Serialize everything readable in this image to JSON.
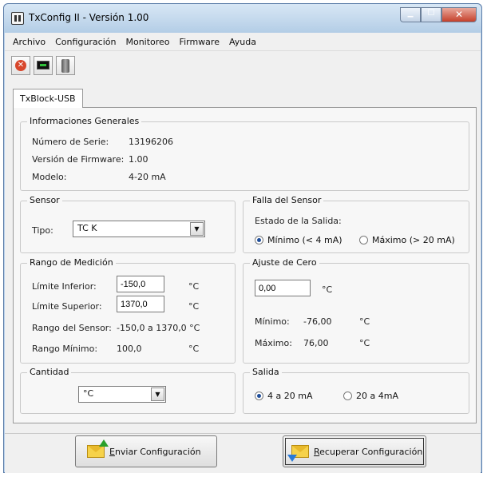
{
  "window": {
    "title": "TxConfig II - Versión 1.00"
  },
  "menu": [
    "Archivo",
    "Configuración",
    "Monitoreo",
    "Firmware",
    "Ayuda"
  ],
  "tab": {
    "label": "TxBlock-USB"
  },
  "info": {
    "title": "Informaciones Generales",
    "serial_label": "Número de Serie:",
    "serial_value": "13196206",
    "firmware_label": "Versión de Firmware:",
    "firmware_value": "1.00",
    "model_label": "Modelo:",
    "model_value": "4-20 mA"
  },
  "sensor": {
    "title": "Sensor",
    "type_label": "Tipo:",
    "type_value": "TC K"
  },
  "fault": {
    "title": "Falla del Sensor",
    "output_state_label": "Estado de la Salida:",
    "min_label": "Mínimo (< 4 mA)",
    "max_label": "Máximo (> 20 mA)",
    "selected": "min"
  },
  "range": {
    "title": "Rango de Medición",
    "lower_label": "Límite Inferior:",
    "lower_value": "-150,0",
    "lower_unit": "°C",
    "upper_label": "Límite Superior:",
    "upper_value": "1370,0",
    "upper_unit": "°C",
    "sensor_range_label": "Rango del Sensor:",
    "sensor_range_value": "-150,0 a 1370,0 °C",
    "min_range_label": "Rango Mínimo:",
    "min_range_value": "100,0",
    "min_range_unit": "°C"
  },
  "zero": {
    "title": "Ajuste de Cero",
    "value": "0,00",
    "unit": "°C",
    "min_label": "Mínimo:",
    "min_value": "-76,00",
    "min_unit": "°C",
    "max_label": "Máximo:",
    "max_value": "76,00",
    "max_unit": "°C"
  },
  "quantity": {
    "title": "Cantidad",
    "value": "°C"
  },
  "output": {
    "title": "Salida",
    "opt1": "4 a 20 mA",
    "opt2": "20 a 4mA",
    "selected": "opt1"
  },
  "buttons": {
    "send_hotkey": "E",
    "send_rest": "nviar Configuración",
    "recover_hotkey": "R",
    "recover_rest": "ecuperar Configuración"
  },
  "colors": {
    "accent_selected_radio": "#1f4e9a",
    "envelope": "#f6d24a",
    "send_arrow": "#2aa02a",
    "recover_arrow": "#2a7ad8",
    "close_button": "#c5402b"
  }
}
